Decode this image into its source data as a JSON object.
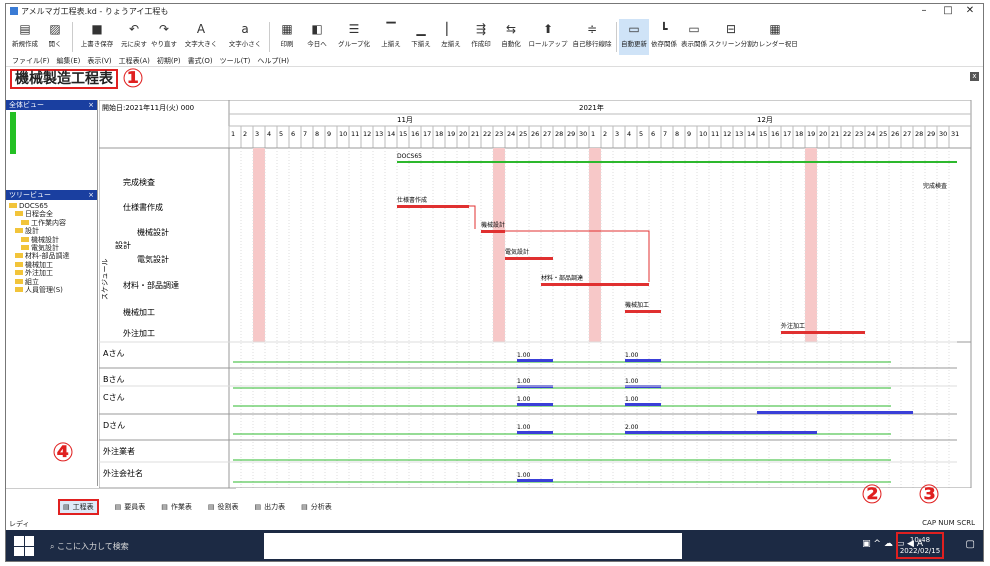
{
  "window": {
    "title": "アメルマガ工程表.kd - りょうアイ工程も"
  },
  "toolbar": [
    {
      "name": "new-button",
      "label": "新規作成",
      "icon": "new-file-icon"
    },
    {
      "name": "open-button",
      "label": "開く",
      "icon": "folder-open-icon"
    },
    {
      "name": "save-button",
      "label": "上書き保存",
      "icon": "save-icon"
    },
    {
      "name": "undo-button",
      "label": "元に戻す",
      "icon": "undo-icon"
    },
    {
      "name": "redo-button",
      "label": "やり直す",
      "icon": "redo-icon"
    },
    {
      "name": "font-up-button",
      "label": "文字大きく",
      "icon": "font-larger-icon"
    },
    {
      "name": "font-down-button",
      "label": "文字小さく",
      "icon": "font-smaller-icon"
    },
    {
      "name": "print-button",
      "label": "印刷",
      "icon": "print-icon"
    },
    {
      "name": "today-button",
      "label": "今日へ",
      "icon": "today-icon"
    },
    {
      "name": "group-button",
      "label": "グループ化",
      "icon": "group-icon"
    },
    {
      "name": "align-top-button",
      "label": "上揃え",
      "icon": "align-top-icon"
    },
    {
      "name": "align-bottom-button",
      "label": "下揃え",
      "icon": "align-bottom-icon"
    },
    {
      "name": "align-left-button",
      "label": "左揃え",
      "icon": "align-left-icon"
    },
    {
      "name": "connect-button",
      "label": "作成印",
      "icon": "connect-icon"
    },
    {
      "name": "auto-button",
      "label": "自動化",
      "icon": "auto-icon"
    },
    {
      "name": "rollup-button",
      "label": "ロールアップ",
      "icon": "rollup-icon"
    },
    {
      "name": "self-line-button",
      "label": "自己移行線除",
      "icon": "self-line-icon"
    },
    {
      "name": "auto-refresh-button",
      "label": "自動更新",
      "icon": "auto-refresh-icon"
    },
    {
      "name": "dependency-button",
      "label": "依存関係",
      "icon": "dependency-icon"
    },
    {
      "name": "display-button",
      "label": "表示関係",
      "icon": "display-icon"
    },
    {
      "name": "split-button",
      "label": "スクリーン分割",
      "icon": "split-icon"
    },
    {
      "name": "calendar-button",
      "label": "カレンダー祝日",
      "icon": "calendar-icon"
    }
  ],
  "menu": [
    "ファイル(F)",
    "編集(E)",
    "表示(V)",
    "工程表(A)",
    "初期(P)",
    "書式(O)",
    "ツール(T)",
    "ヘルプ(H)"
  ],
  "page": {
    "title": "機械製造工程表"
  },
  "annotations": [
    "①",
    "②",
    "③",
    "④"
  ],
  "left_pane": {
    "overview_title": "全体ビュー",
    "tree_title": "ツリービュー",
    "tree": [
      "DOCS65",
      "日程会全",
      "工作業内容",
      "設計",
      "機械設計",
      "電気設計",
      "材料-部品調達",
      "機械加工",
      "外注加工",
      "組立",
      "人員管理(S)"
    ]
  },
  "chart_header": {
    "start_label": "開始日:2021年11月(火) 000",
    "year": "2021年",
    "months": [
      "11月",
      "12月"
    ],
    "days": [
      "1",
      "2",
      "3",
      "4",
      "5",
      "6",
      "7",
      "8",
      "9",
      "10",
      "11",
      "12",
      "13",
      "14",
      "15",
      "16",
      "17",
      "18",
      "19",
      "20",
      "21",
      "22",
      "23",
      "24",
      "25",
      "26",
      "27",
      "28",
      "29",
      "30",
      "1",
      "2",
      "3",
      "4",
      "5",
      "6",
      "7",
      "8",
      "9",
      "10",
      "11",
      "12",
      "13",
      "14",
      "15",
      "16",
      "17",
      "18",
      "19",
      "20",
      "21",
      "22",
      "23",
      "24",
      "25",
      "26",
      "27",
      "28",
      "29",
      "30",
      "31"
    ]
  },
  "tasks": {
    "group_label": "スケジュール",
    "design_label": "設計",
    "items": [
      {
        "label": "完成検査"
      },
      {
        "label": "仕様書作成",
        "bar": "仕様書作成"
      },
      {
        "label": "機械設計",
        "bar": "機械設計"
      },
      {
        "label": "電気設計",
        "bar": "電気設計"
      },
      {
        "label": "材料・部品調達",
        "bar": "材料・部品調達"
      },
      {
        "label": "機械加工",
        "bar": "機械加工"
      },
      {
        "label": "外注加工",
        "bar": "外注加工"
      }
    ],
    "project_bar": "DOCS65",
    "right_note": "完成検査"
  },
  "resources": {
    "rows": [
      {
        "label": "Aさん",
        "value_a": "1.00",
        "value_b": "1.00"
      },
      {
        "label": "Bさん",
        "value_a": "1.00",
        "value_b": "1.00"
      },
      {
        "label": "Cさん",
        "value_a": "1.00",
        "value_b": "1.00"
      },
      {
        "label": "Dさん",
        "value_a": "1.00",
        "value_b": "2.00"
      },
      {
        "label": "外注業者"
      },
      {
        "label": "外注会社名",
        "value_a": "1.00"
      }
    ]
  },
  "view_tabs": [
    "工程表",
    "要員表",
    "作業表",
    "役割表",
    "出力表",
    "分析表"
  ],
  "status": {
    "left": "レディ",
    "right": "CAP NUM SCRL"
  },
  "taskbar": {
    "search": "ここに入力して検索",
    "time": "10:48",
    "date": "2022/02/15"
  },
  "colors": {
    "accent_red": "#e02020",
    "taskbar": "#1c2a44",
    "bar_red": "#e03030",
    "bar_blue": "#3a3fd8",
    "line_green": "#2db82d"
  }
}
